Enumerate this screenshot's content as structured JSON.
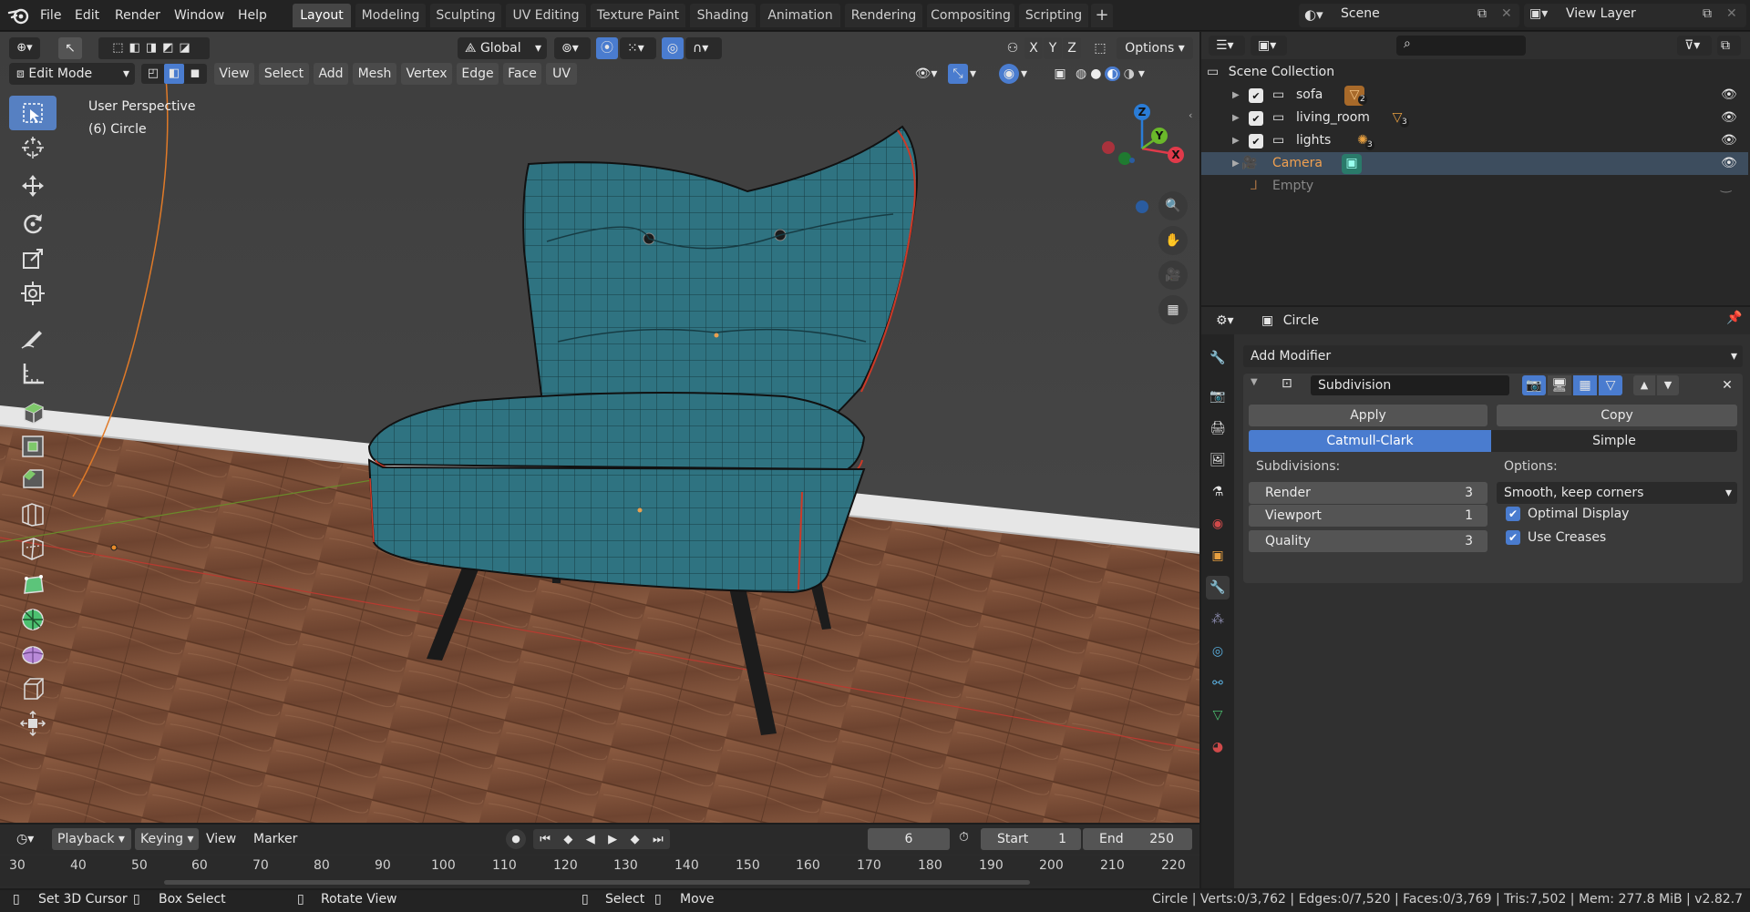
{
  "app": {
    "menus": [
      "File",
      "Edit",
      "Render",
      "Window",
      "Help"
    ],
    "workspaces": [
      "Layout",
      "Modeling",
      "Sculpting",
      "UV Editing",
      "Texture Paint",
      "Shading",
      "Animation",
      "Rendering",
      "Compositing",
      "Scripting"
    ],
    "active_workspace": "Layout",
    "add_tab": "+",
    "scene": "Scene",
    "view_layer": "View Layer"
  },
  "viewport": {
    "transform_orientation": "Global",
    "options_label": "Options",
    "axis_x": "X",
    "axis_y": "Y",
    "axis_z": "Z",
    "mode": "Edit Mode",
    "header_menus": [
      "View",
      "Select",
      "Add",
      "Mesh",
      "Vertex",
      "Edge",
      "Face",
      "UV"
    ],
    "overlay_title": "User Perspective",
    "overlay_object": "(6) Circle",
    "gizmo_axes": {
      "x": "X",
      "y": "Y",
      "z": "Z"
    }
  },
  "outliner": {
    "root": "Scene Collection",
    "items": [
      {
        "label": "sofa",
        "badge": "2",
        "checked": true
      },
      {
        "label": "living_room",
        "badge": "3",
        "checked": true
      },
      {
        "label": "lights",
        "badge": "3",
        "checked": true
      },
      {
        "label": "Camera",
        "selected": true
      },
      {
        "label": "Empty",
        "dim": true
      }
    ]
  },
  "properties": {
    "object_name": "Circle",
    "add_modifier": "Add Modifier",
    "modifier_name": "Subdivision",
    "apply": "Apply",
    "copy": "Copy",
    "algo_options": [
      "Catmull-Clark",
      "Simple"
    ],
    "active_algo": "Catmull-Clark",
    "subdivisions_label": "Subdivisions:",
    "options_label": "Options:",
    "fields": [
      {
        "label": "Render",
        "value": "3"
      },
      {
        "label": "Viewport",
        "value": "1"
      },
      {
        "label": "Quality",
        "value": "3"
      }
    ],
    "uv_smooth": "Smooth, keep corners",
    "optimal_display": "Optimal Display",
    "use_creases": "Use Creases"
  },
  "timeline": {
    "menus": [
      "Playback",
      "Keying",
      "View",
      "Marker"
    ],
    "current_frame": "6",
    "start_label": "Start",
    "start": "1",
    "end_label": "End",
    "end": "250",
    "ruler": [
      "30",
      "40",
      "50",
      "60",
      "70",
      "80",
      "90",
      "100",
      "110",
      "120",
      "130",
      "140",
      "150",
      "160",
      "170",
      "180",
      "190",
      "200",
      "210",
      "220"
    ]
  },
  "status": {
    "set_cursor": "Set 3D Cursor",
    "box_select": "Box Select",
    "rotate_view": "Rotate View",
    "select": "Select",
    "move": "Move",
    "stats": "Circle | Verts:0/3,762 | Edges:0/7,520 | Faces:0/3,769 | Tris:7,502 | Mem: 277.8 MiB | v2.82.7"
  },
  "colors": {
    "accent": "#4a7ccf",
    "selection": "#5680c2",
    "chair": "#2e6f7c",
    "floor": "#7a4a34"
  }
}
